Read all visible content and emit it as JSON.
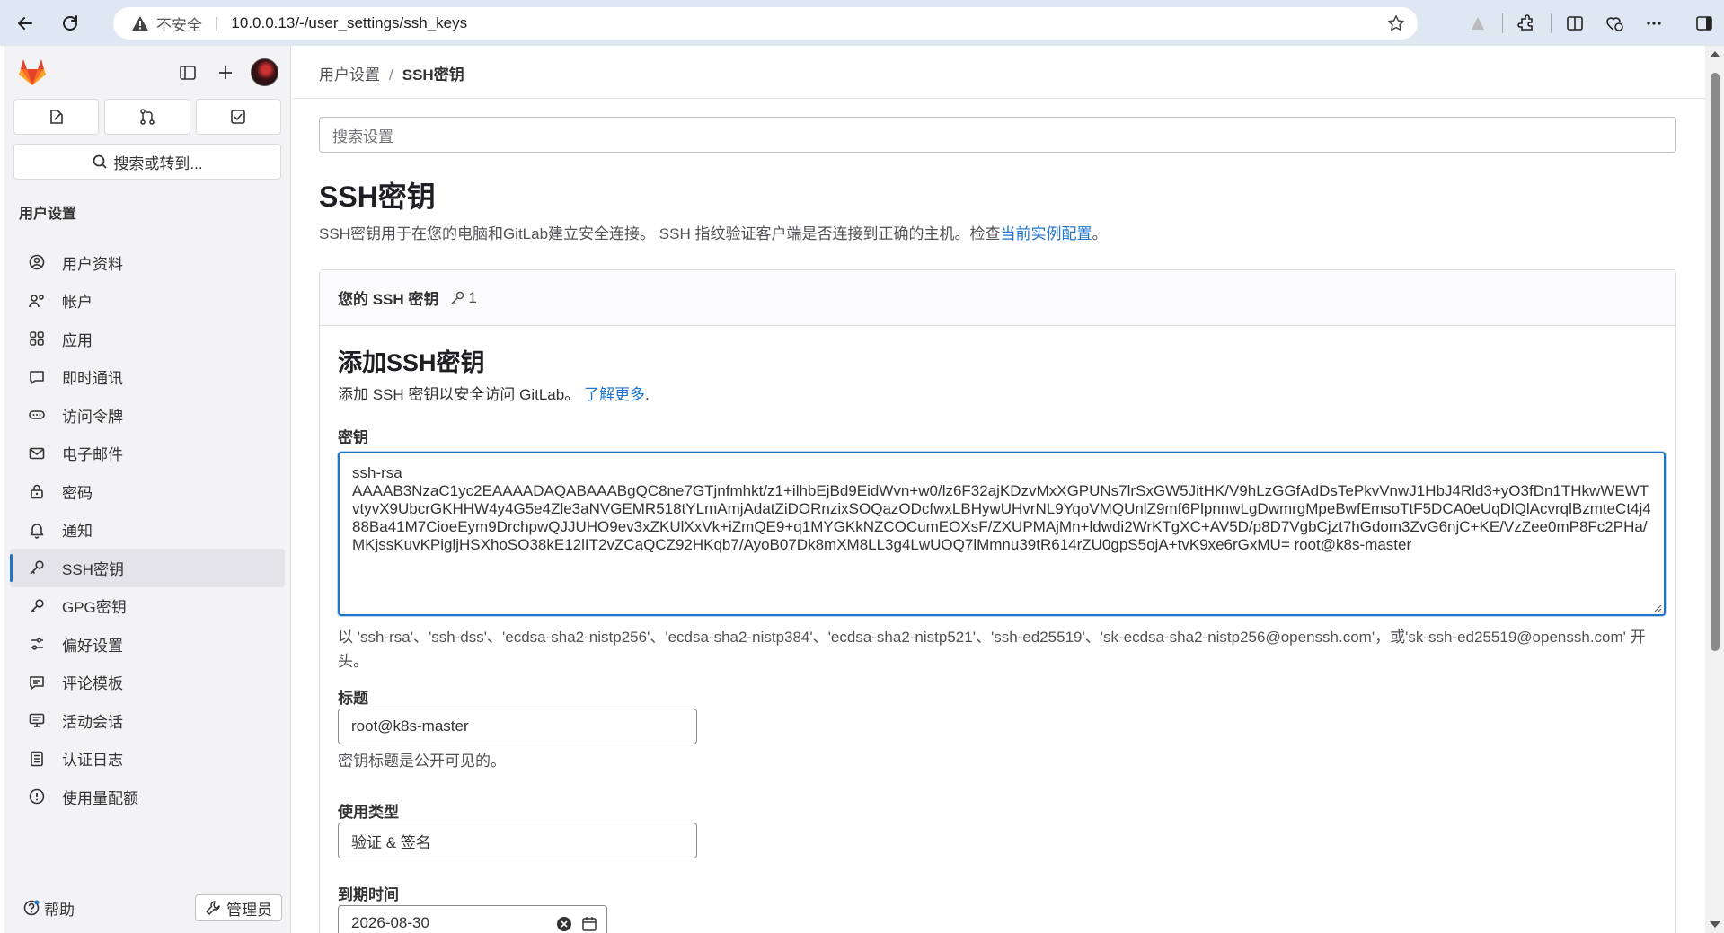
{
  "browser": {
    "insecure_label": "不安全",
    "url": "10.0.0.13/-/user_settings/ssh_keys"
  },
  "sidebar": {
    "search_label": "搜索或转到...",
    "section_title": "用户设置",
    "items": [
      {
        "label": "用户资料",
        "icon": "profile-icon"
      },
      {
        "label": "帐户",
        "icon": "account-icon"
      },
      {
        "label": "应用",
        "icon": "applications-icon"
      },
      {
        "label": "即时通讯",
        "icon": "chat-icon"
      },
      {
        "label": "访问令牌",
        "icon": "token-icon"
      },
      {
        "label": "电子邮件",
        "icon": "mail-icon"
      },
      {
        "label": "密码",
        "icon": "lock-icon"
      },
      {
        "label": "通知",
        "icon": "bell-icon"
      },
      {
        "label": "SSH密钥",
        "icon": "key-icon"
      },
      {
        "label": "GPG密钥",
        "icon": "key-icon"
      },
      {
        "label": "偏好设置",
        "icon": "preferences-icon"
      },
      {
        "label": "评论模板",
        "icon": "comment-template-icon"
      },
      {
        "label": "活动会话",
        "icon": "monitor-icon"
      },
      {
        "label": "认证日志",
        "icon": "log-icon"
      },
      {
        "label": "使用量配额",
        "icon": "quota-icon"
      }
    ],
    "active_index": 8,
    "help_label": "帮助",
    "admin_label": "管理员"
  },
  "breadcrumb": {
    "parent": "用户设置",
    "separator": "/",
    "current": "SSH密钥"
  },
  "search_settings_placeholder": "搜索设置",
  "page": {
    "title": "SSH密钥",
    "description": "SSH密钥用于在您的电脑和GitLab建立安全连接。 SSH 指纹验证客户端是否连接到正确的主机。检查",
    "description_link": "当前实例配置",
    "description_end": "。"
  },
  "card": {
    "header": "您的 SSH 密钥",
    "key_count": "1"
  },
  "form": {
    "title": "添加SSH密钥",
    "subtitle": "添加 SSH 密钥以安全访问 GitLab。",
    "learn_more": "了解更多",
    "learn_more_end": ".",
    "key_label": "密钥",
    "key_value": "ssh-rsa\nAAAAB3NzaC1yc2EAAAADAQABAAABgQC8ne7GTjnfmhkt/z1+ilhbEjBd9EidWvn+w0/lz6F32ajKDzvMxXGPUNs7lrSxGW5JitHK/V9hLzGGfAdDsTePkvVnwJ1HbJ4Rld3+yO3fDn1THkwWEWTvtyvX9UbcrGKHHW4y4G5e4Zle3aNVGEMR518tYLmAmjAdatZiDORnzixSOQazODcfwxLBHywUHvrNL9YqoVMQUnlZ9mf6PlpnnwLgDwmrgMpeBwfEmsoTtF5DCA0eUqDlQlAcvrqlBzmteCt4j488Ba41M7CioeEym9DrchpwQJJUHO9ev3xZKUlXxVk+iZmQE9+q1MYGKkNZCOCumEOXsF/ZXUPMAjMn+ldwdi2WrKTgXC+AV5D/p8D7VgbCjzt7hGdom3ZvG6njC+KE/VzZee0mP8Fc2PHa/MKjssKuvKPigljHSXhoSO38kE12lIT2vZCaQCZ92HKqb7/AyoB07Dk8mXM8LL3g4LwUOQ7lMmnu39tR614rZU0gpS5ojA+tvK9xe6rGxMU= root@k8s-master",
    "key_hint": "以 'ssh-rsa'、'ssh-dss'、'ecdsa-sha2-nistp256'、'ecdsa-sha2-nistp384'、'ecdsa-sha2-nistp521'、'ssh-ed25519'、'sk-ecdsa-sha2-nistp256@openssh.com'，或'sk-ssh-ed25519@openssh.com' 开头。",
    "title_label": "标题",
    "title_value": "root@k8s-master",
    "title_hint": "密钥标题是公开可见的。",
    "usage_label": "使用类型",
    "usage_value": "验证 & 签名",
    "expiry_label": "到期时间",
    "expiry_value": "2026-08-30"
  },
  "colors": {
    "accent": "#1f75cb",
    "gitlab_orange": "#fc6d26"
  }
}
